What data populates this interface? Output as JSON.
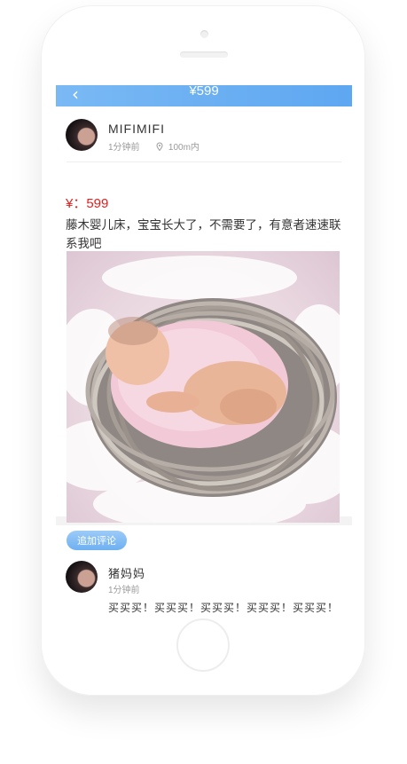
{
  "nav": {
    "back_icon": "chevron-left-icon",
    "title": "¥599"
  },
  "post": {
    "username": "MIFIMIFI",
    "time": "1分钟前",
    "distance": "100m内",
    "price": "¥：599",
    "description": "藤木婴儿床，宝宝长大了，不需要了，有意者速速联系我吧"
  },
  "comments": {
    "add_label": "追加评论",
    "items": [
      {
        "username": "猪妈妈",
        "time": "1分钟前",
        "text": "买买买！买买买！买买买！买买买！买买买！"
      }
    ]
  },
  "colors": {
    "nav_start": "#7ab9f4",
    "nav_end": "#5ea7f1",
    "price": "#e02020"
  }
}
